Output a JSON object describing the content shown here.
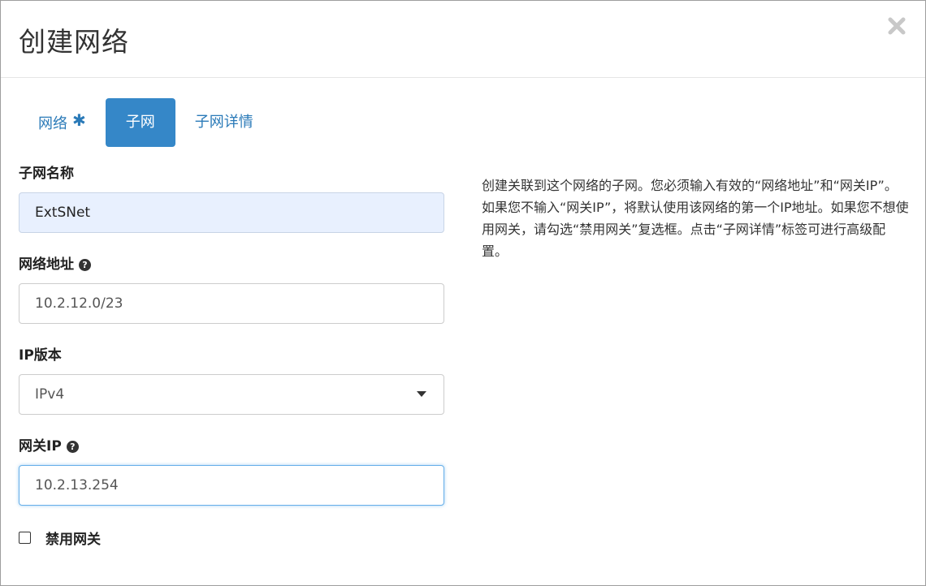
{
  "modal": {
    "title": "创建网络",
    "close_icon": "close-icon"
  },
  "tabs": [
    {
      "label": "网络",
      "required_mark": "✱",
      "active": false
    },
    {
      "label": "子网",
      "active": true
    },
    {
      "label": "子网详情",
      "active": false
    }
  ],
  "form": {
    "subnet_name": {
      "label": "子网名称",
      "value": "ExtSNet"
    },
    "network_address": {
      "label": "网络地址",
      "help_icon": "question-circle-icon",
      "value": "10.2.12.0/23"
    },
    "ip_version": {
      "label": "IP版本",
      "selected": "IPv4"
    },
    "gateway_ip": {
      "label": "网关IP",
      "help_icon": "question-circle-icon",
      "value": "10.2.13.254"
    },
    "disable_gateway": {
      "label": "禁用网关",
      "checked": false
    }
  },
  "help_text": "创建关联到这个网络的子网。您必须输入有效的“网络地址”和“网关IP”。如果您不输入“网关IP”，将默认使用该网络的第一个IP地址。如果您不想使用网关，请勾选“禁用网关”复选框。点击“子网详情”标签可进行高级配置。",
  "colors": {
    "accent": "#3587c8",
    "link": "#2a7ab8",
    "autofill_bg": "#e8f0fe"
  }
}
